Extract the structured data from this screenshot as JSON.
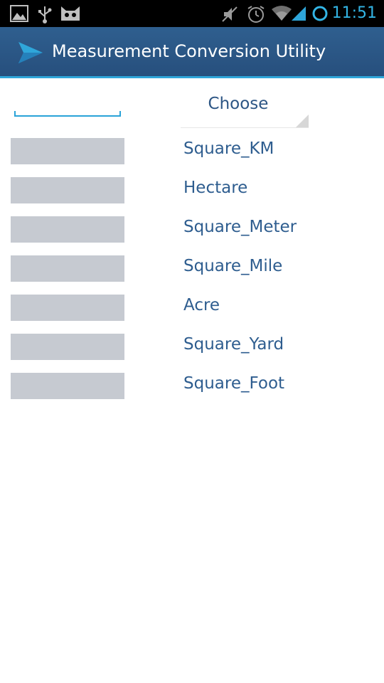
{
  "status_bar": {
    "time": "11:51",
    "icons": [
      "image-icon",
      "usb-icon",
      "cyanogen-mascot-icon",
      "mute-icon",
      "alarm-icon",
      "wifi-icon",
      "signal-icon",
      "sync-ring-icon"
    ],
    "accent_color": "#33b5e5"
  },
  "action_bar": {
    "title": "Measurement Conversion Utility",
    "icon": "send-arrow-icon",
    "color": "#2b5788"
  },
  "converter": {
    "input_value": "",
    "input_placeholder": "",
    "spinner_label": "Choose",
    "rows": [
      {
        "unit": "Square_KM",
        "result": ""
      },
      {
        "unit": "Hectare",
        "result": ""
      },
      {
        "unit": "Square_Meter",
        "result": ""
      },
      {
        "unit": "Square_Mile",
        "result": ""
      },
      {
        "unit": "Acre",
        "result": ""
      },
      {
        "unit": "Square_Yard",
        "result": ""
      },
      {
        "unit": "Square_Foot",
        "result": ""
      }
    ],
    "label_color": "#2e5d8f",
    "result_box_color": "#c6cad1"
  }
}
